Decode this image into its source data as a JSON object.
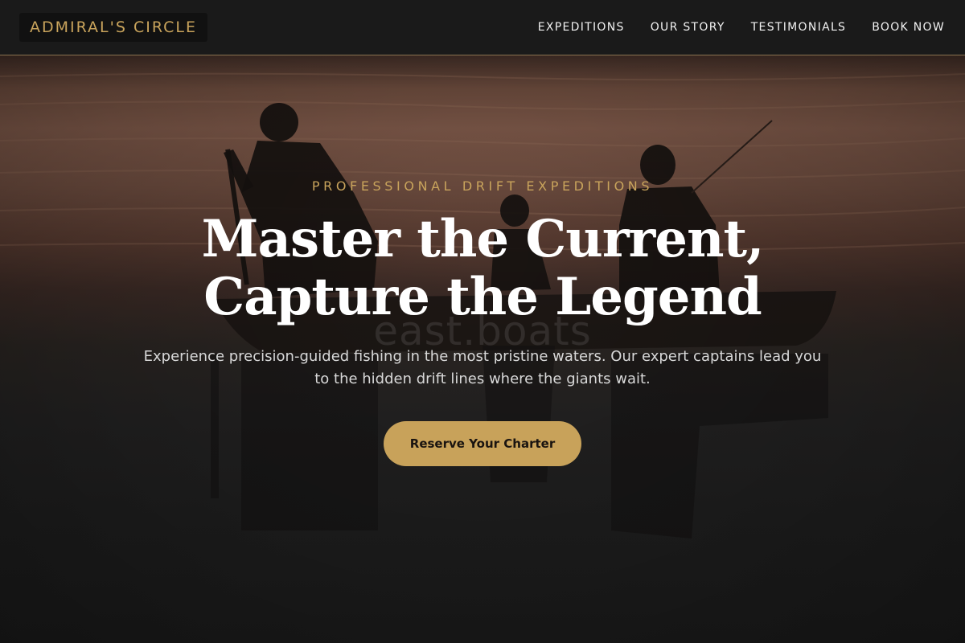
{
  "header": {
    "logo_text": "ADMIRAL'S CIRCLE",
    "nav": [
      {
        "label": "EXPEDITIONS"
      },
      {
        "label": "OUR STORY"
      },
      {
        "label": "TESTIMONIALS"
      },
      {
        "label": "BOOK NOW"
      }
    ]
  },
  "hero": {
    "eyebrow": "PROFESSIONAL DRIFT EXPEDITIONS",
    "headline_line1": "Master the Current,",
    "headline_line2": "Capture the Legend",
    "watermark": "east.boats",
    "subtext": "Experience precision-guided fishing in the most pristine waters. Our expert captains lead you to the hidden drift lines where the giants wait.",
    "cta_label": "Reserve Your Charter",
    "background_image": "silhouette-fishermen-boat-sunset-icon"
  },
  "colors": {
    "accent_gold": "#c9a45c",
    "header_bg": "#1a1a1a",
    "cta_bg": "#c8a25a",
    "headline_text": "#ffffff"
  }
}
